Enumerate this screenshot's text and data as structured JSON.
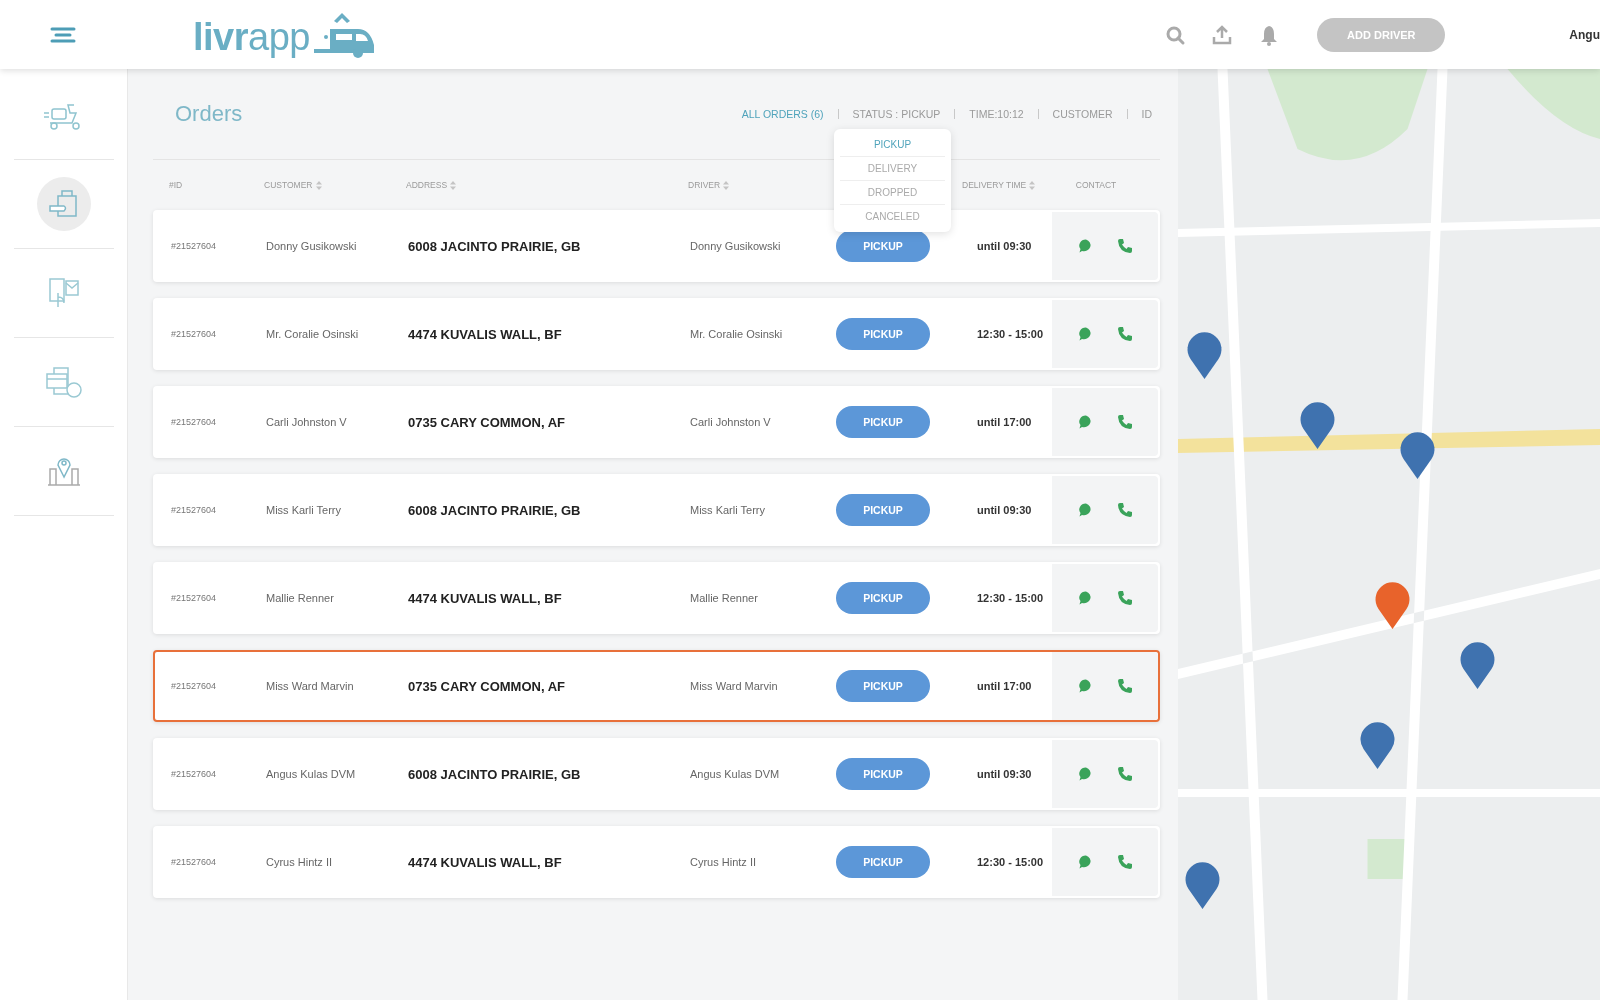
{
  "header": {
    "logo": "**livr**app",
    "add_button": "ADD DRIVER",
    "user": "Angu"
  },
  "sidebar": {
    "items": [
      {
        "selected": false
      },
      {
        "selected": true
      },
      {
        "selected": false
      },
      {
        "selected": false
      },
      {
        "selected": false
      }
    ]
  },
  "orders": {
    "title": "Orders",
    "filters": [
      {
        "label": "ALL ORDERS (6)",
        "selected": true
      },
      {
        "label": "STATUS : PICKUP",
        "selected": false
      },
      {
        "label": "TIME:10:12",
        "selected": false
      },
      {
        "label": "CUSTOMER",
        "selected": false
      },
      {
        "label": "ID",
        "selected": false
      }
    ],
    "status_menu": [
      {
        "label": "PICKUP",
        "selected": true
      },
      {
        "label": "DELIVERY",
        "selected": false
      },
      {
        "label": "DROPPED",
        "selected": false
      },
      {
        "label": "CANCELED",
        "selected": false
      }
    ],
    "columns": [
      {
        "label": "#ID",
        "sortable": false
      },
      {
        "label": "CUSTOMER",
        "sortable": true
      },
      {
        "label": "ADDRESS",
        "sortable": true
      },
      {
        "label": "DRIVER",
        "sortable": true
      },
      {
        "label": "DELIVERY TIME",
        "sortable": true
      },
      {
        "label": "CONTACT",
        "sortable": false
      }
    ],
    "rows": [
      {
        "id": "#21527604",
        "customer": "Donny Gusikowski",
        "address": "6008 JACINTO PRAIRIE, GB",
        "driver": "Donny Gusikowski",
        "status": "PICKUP",
        "time": "until 09:30",
        "selected": false
      },
      {
        "id": "#21527604",
        "customer": "Mr. Coralie Osinski",
        "address": "4474 KUVALIS WALL, BF",
        "driver": "Mr. Coralie Osinski",
        "status": "PICKUP",
        "time": "12:30 - 15:00",
        "selected": false
      },
      {
        "id": "#21527604",
        "customer": "Carli Johnston V",
        "address": "0735 CARY COMMON, AF",
        "driver": "Carli Johnston V",
        "status": "PICKUP",
        "time": "until 17:00",
        "selected": false
      },
      {
        "id": "#21527604",
        "customer": "Miss Karli Terry",
        "address": "6008 JACINTO PRAIRIE, GB",
        "driver": "Miss Karli Terry",
        "status": "PICKUP",
        "time": "until 09:30",
        "selected": false
      },
      {
        "id": "#21527604",
        "customer": "Mallie Renner",
        "address": "4474 KUVALIS WALL, BF",
        "driver": "Mallie Renner",
        "status": "PICKUP",
        "time": "12:30 - 15:00",
        "selected": false
      },
      {
        "id": "#21527604",
        "customer": "Miss Ward Marvin",
        "address": "0735 CARY COMMON, AF",
        "driver": "Miss Ward Marvin",
        "status": "PICKUP",
        "time": "until 17:00",
        "selected": true
      },
      {
        "id": "#21527604",
        "customer": "Angus Kulas DVM",
        "address": "6008 JACINTO PRAIRIE, GB",
        "driver": "Angus Kulas DVM",
        "status": "PICKUP",
        "time": "until 09:30",
        "selected": false
      },
      {
        "id": "#21527604",
        "customer": "Cyrus Hintz II",
        "address": "4474 KUVALIS WALL, BF",
        "driver": "Cyrus Hintz II",
        "status": "PICKUP",
        "time": "12:30 - 15:00",
        "selected": false
      }
    ]
  }
}
